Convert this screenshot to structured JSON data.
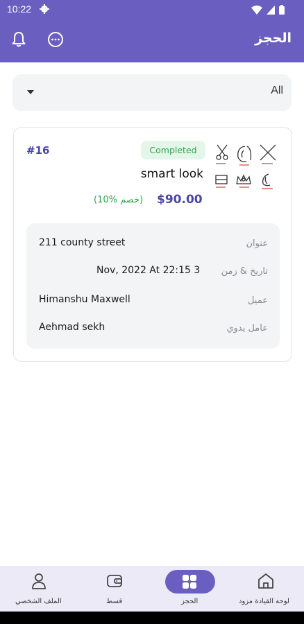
{
  "status_bar": {
    "time": "10:22"
  },
  "app_bar": {
    "title": "الحجز"
  },
  "filter": {
    "value": "All"
  },
  "booking": {
    "id": "#16",
    "status": "Completed",
    "salon_name": "smart look",
    "price": "$90.00",
    "discount": "(10% خصم)",
    "details": [
      {
        "label": "عنوان",
        "value": "211 county street"
      },
      {
        "label": "تاريخ & زمن",
        "value": "Nov, 2022 At 22:15 3"
      },
      {
        "label": "عميل",
        "value": "Himanshu Maxwell"
      },
      {
        "label": "عامل يدوي",
        "value": "Aehmad sekh"
      }
    ]
  },
  "bottom_nav": {
    "items": [
      {
        "label": "لوحة القيادة مزود",
        "icon": "home-icon"
      },
      {
        "label": "الحجز",
        "icon": "booking-grid-icon",
        "active": true
      },
      {
        "label": "قسط",
        "icon": "wallet-icon"
      },
      {
        "label": "الملف الشخصي",
        "icon": "profile-icon"
      }
    ]
  },
  "colors": {
    "primary": "#6a5fc1",
    "accent_text": "#4b45a8",
    "success": "#2ea44f",
    "panel": "#f3f4f6"
  }
}
